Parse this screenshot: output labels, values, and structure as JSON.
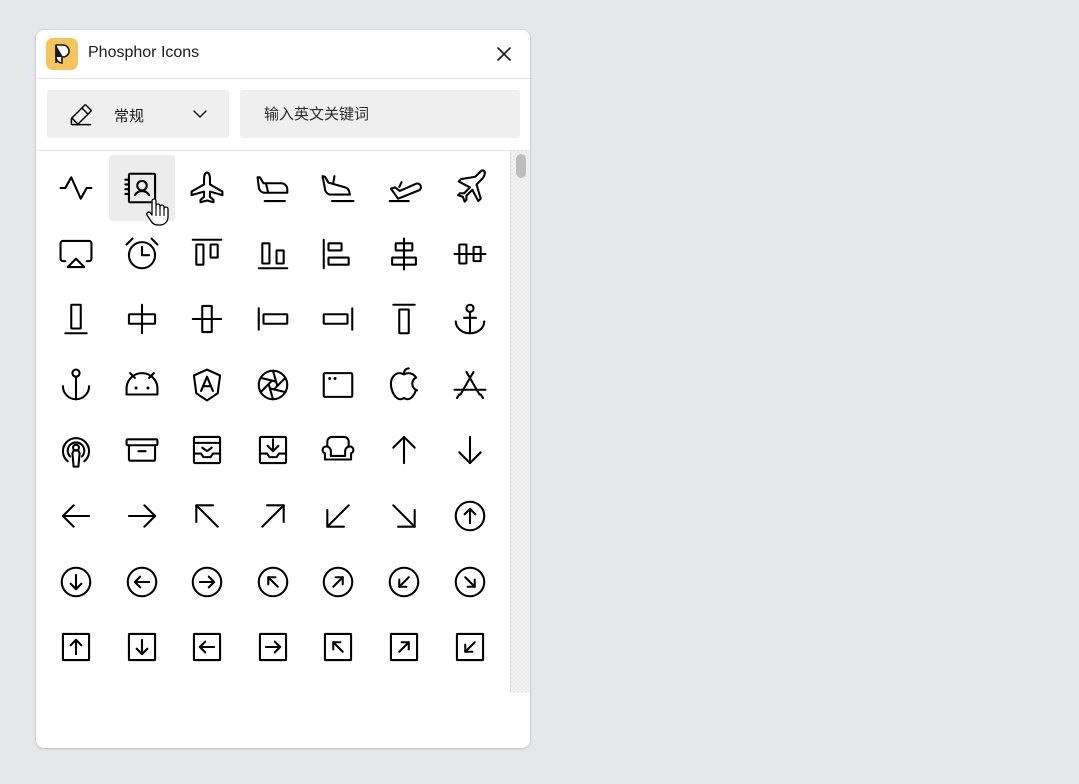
{
  "window": {
    "title": "Phosphor Icons",
    "close_icon": "close-icon",
    "logo_icon": "phosphor-logo-icon"
  },
  "toolbar": {
    "category": {
      "icon": "pencil-icon",
      "label": "常规",
      "chevron": "chevron-down-icon"
    },
    "search": {
      "placeholder": "输入英文关键词",
      "value": ""
    }
  },
  "icons": [
    "activity-icon",
    "address-book-icon",
    "airplane-icon",
    "airplane-in-flight-icon",
    "airplane-landing-icon",
    "airplane-takeoff-icon",
    "airplane-tilt-icon",
    "airplay-icon",
    "alarm-icon",
    "align-top-icon",
    "align-bottom-icon",
    "align-left-icon",
    "align-center-horizontal-icon",
    "align-center-vertical-icon",
    "align-bottom-simple-icon",
    "align-center-horizontal-simple-icon",
    "align-center-vertical-simple-icon",
    "align-left-simple-icon",
    "align-right-simple-icon",
    "align-top-simple-icon",
    "anchor-icon",
    "anchor-simple-icon",
    "android-logo-icon",
    "angular-logo-icon",
    "aperture-icon",
    "app-window-icon",
    "apple-logo-icon",
    "app-store-logo-icon",
    "apple-podcasts-logo-icon",
    "archive-icon",
    "archive-box-icon",
    "archive-tray-icon",
    "armchair-icon",
    "arrow-up-icon",
    "arrow-down-icon",
    "arrow-left-icon",
    "arrow-right-icon",
    "arrow-up-left-icon",
    "arrow-up-right-icon",
    "arrow-down-left-icon",
    "arrow-down-right-icon",
    "arrow-circle-up-icon",
    "arrow-circle-down-icon",
    "arrow-circle-left-icon",
    "arrow-circle-right-icon",
    "arrow-circle-up-left-icon",
    "arrow-circle-up-right-icon",
    "arrow-circle-down-left-icon",
    "arrow-circle-down-right-icon",
    "arrow-square-up-icon",
    "arrow-square-down-icon",
    "arrow-square-left-icon",
    "arrow-square-right-icon",
    "arrow-square-up-left-icon",
    "arrow-square-up-right-icon",
    "arrow-square-down-left-icon"
  ],
  "hovered_icon": "address-book-icon",
  "cursor_icon": "hand-pointer-icon",
  "colors": {
    "background": "#e6e7e9",
    "panel": "#ffffff",
    "control_bg": "#efefef",
    "hover_bg": "#ececec",
    "logo_accent": "#f5c45a",
    "icon_stroke": "#000000"
  }
}
